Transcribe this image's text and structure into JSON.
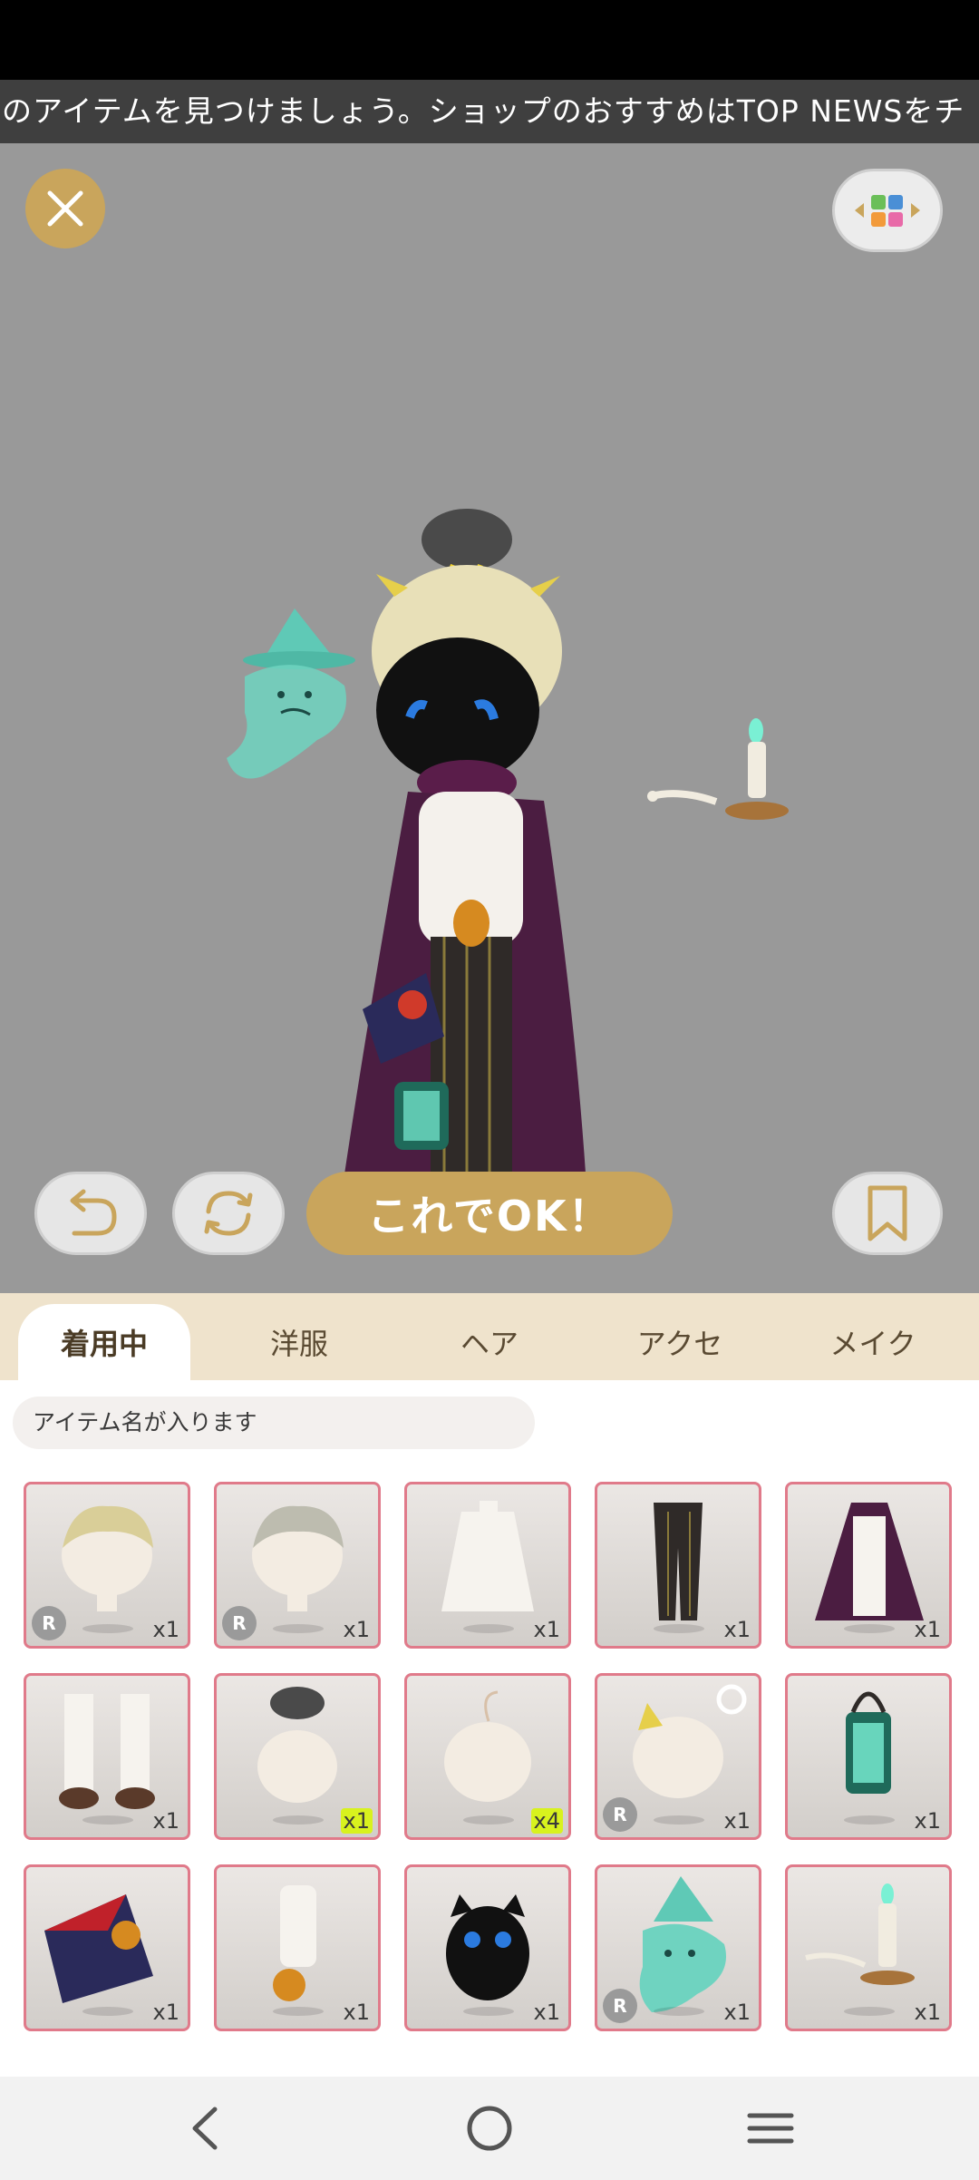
{
  "ticker": {
    "text": "のアイテムを見つけましょう。ショップのおすすめはTOP NEWSをチ"
  },
  "stage": {
    "close_icon": "close-icon",
    "layout_icon": "color-grid-icon",
    "undo_icon": "undo-icon",
    "rotate_icon": "rotate-icon",
    "bookmark_icon": "bookmark-icon",
    "ok_label": "これでOK！"
  },
  "tabs": [
    {
      "label": "着用中",
      "active": true
    },
    {
      "label": "洋服",
      "active": false
    },
    {
      "label": "ヘア",
      "active": false
    },
    {
      "label": "アクセ",
      "active": false
    },
    {
      "label": "メイク",
      "active": false
    }
  ],
  "search": {
    "placeholder": "アイテム名が入ります"
  },
  "items": [
    {
      "name": "blonde-hair",
      "qty": "x1",
      "rare": "R",
      "highlight": false
    },
    {
      "name": "grey-hair",
      "qty": "x1",
      "rare": "R",
      "highlight": false
    },
    {
      "name": "white-blouse",
      "qty": "x1",
      "rare": "",
      "highlight": false
    },
    {
      "name": "striped-pants",
      "qty": "x1",
      "rare": "",
      "highlight": false
    },
    {
      "name": "purple-cape",
      "qty": "x1",
      "rare": "",
      "highlight": false
    },
    {
      "name": "white-socks-shoes",
      "qty": "x1",
      "rare": "",
      "highlight": false
    },
    {
      "name": "storm-cloud-hat",
      "qty": "x1",
      "rare": "",
      "highlight": true
    },
    {
      "name": "hair-sprout",
      "qty": "x4",
      "rare": "",
      "highlight": true
    },
    {
      "name": "cat-ear-hair",
      "qty": "x1",
      "rare": "R",
      "highlight": false
    },
    {
      "name": "green-lantern",
      "qty": "x1",
      "rare": "",
      "highlight": false
    },
    {
      "name": "spellbook-key",
      "qty": "x1",
      "rare": "",
      "highlight": false
    },
    {
      "name": "gold-pendant",
      "qty": "x1",
      "rare": "",
      "highlight": false
    },
    {
      "name": "black-owl",
      "qty": "x1",
      "rare": "",
      "highlight": false
    },
    {
      "name": "ghost-witch",
      "qty": "x1",
      "rare": "R",
      "highlight": false
    },
    {
      "name": "candle-skeleton",
      "qty": "x1",
      "rare": "",
      "highlight": false
    }
  ],
  "nav": {
    "back_icon": "back-icon",
    "home_icon": "home-icon",
    "menu_icon": "recents-icon"
  }
}
